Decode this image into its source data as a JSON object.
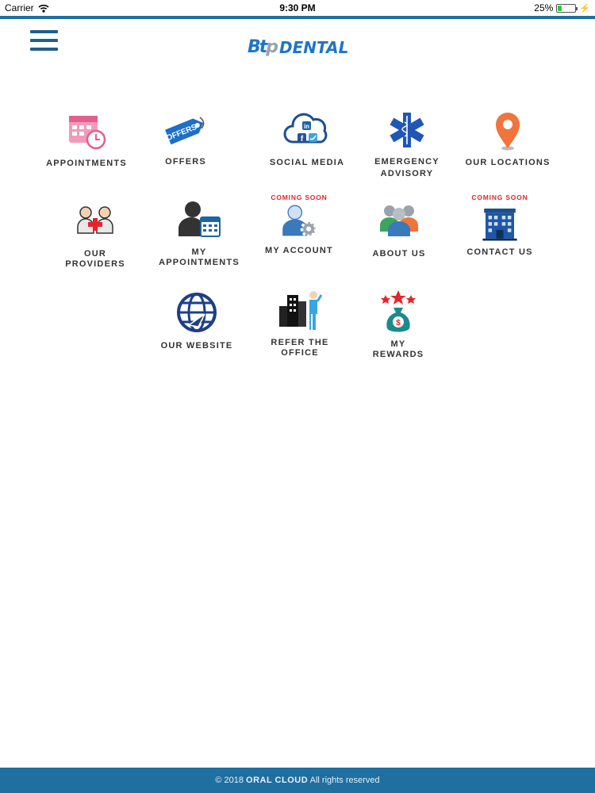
{
  "status_bar": {
    "carrier": "Carrier",
    "time": "9:30 PM",
    "battery": "25%",
    "battery_level": 0.25
  },
  "header": {
    "logo_mark_a": "Bt",
    "logo_mark_b": "p",
    "logo_text": "DENTAL"
  },
  "tiles": [
    {
      "line1": "APPOINTMENTS",
      "line2": "",
      "badge": ""
    },
    {
      "line1": "OFFERS",
      "line2": "",
      "badge": "",
      "icon_text": "OFFERS"
    },
    {
      "line1": "SOCIAL MEDIA",
      "line2": "",
      "badge": ""
    },
    {
      "line1": "EMERGENCY",
      "line2": "ADVISORY",
      "badge": ""
    },
    {
      "line1": "OUR LOCATIONS",
      "line2": "",
      "badge": ""
    },
    {
      "line1": "OUR",
      "line2": "PROVIDERS",
      "badge": ""
    },
    {
      "line1": "MY",
      "line2": "APPOINTMENTS",
      "badge": ""
    },
    {
      "line1": "MY ACCOUNT",
      "line2": "",
      "badge": "COMING SOON"
    },
    {
      "line1": "ABOUT US",
      "line2": "",
      "badge": ""
    },
    {
      "line1": "CONTACT US",
      "line2": "",
      "badge": "COMING SOON"
    },
    {
      "line1": "OUR WEBSITE",
      "line2": "",
      "badge": ""
    },
    {
      "line1": "REFER THE",
      "line2": "OFFICE",
      "badge": ""
    },
    {
      "line1": "MY",
      "line2": "REWARDS",
      "badge": ""
    }
  ],
  "footer": {
    "prefix": "© 2018",
    "brand": "ORAL CLOUD",
    "suffix": "All rights reserved"
  },
  "colors": {
    "brand_blue": "#1f6fa1",
    "logo_blue": "#1e75c8",
    "badge_red": "#e4242b"
  }
}
